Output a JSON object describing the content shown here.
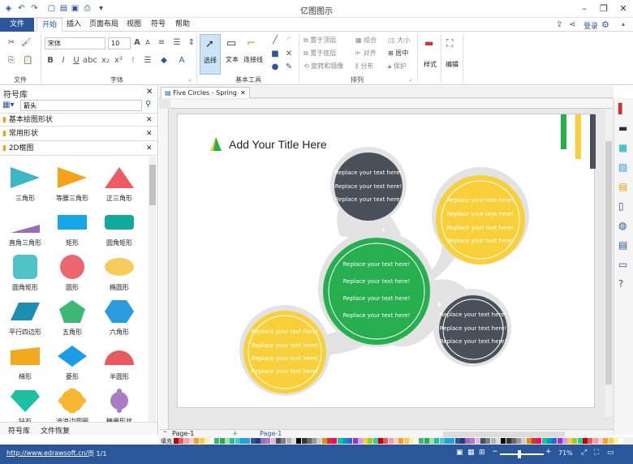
{
  "app": {
    "title": "亿图图示"
  },
  "window": {
    "login": "登录"
  },
  "tabs": [
    "文件",
    "开始",
    "插入",
    "页面布局",
    "视图",
    "符号",
    "帮助"
  ],
  "ribbon": {
    "font_name": "宋体",
    "font_size": "10",
    "groups": {
      "file": "文件",
      "font": "字体",
      "basic_tools": "基本工具",
      "arrange": "排列"
    },
    "tools": {
      "select": "选择",
      "text": "文本",
      "connector": "连接线"
    },
    "arrange": {
      "bring_front": "置于顶层",
      "send_back": "置于底层",
      "rotate": "旋转和镜像",
      "group": "组合",
      "align": "对齐",
      "distribute": "分布",
      "size": "大小",
      "center": "居中",
      "protect": "保护"
    },
    "style": "样式",
    "edit": "编辑"
  },
  "library": {
    "title": "符号库",
    "search_value": "箭头",
    "categories": [
      "基本绘图形状",
      "常用形状",
      "2D框图"
    ],
    "shapes": [
      {
        "label": "三角形",
        "color": "#3fb6c4"
      },
      {
        "label": "等腰三角形",
        "color": "#f7a21b"
      },
      {
        "label": "正三角形",
        "color": "#ec5b62"
      },
      {
        "label": "直角三角形",
        "color": "#9b6bb5"
      },
      {
        "label": "矩形",
        "color": "#16a6e8"
      },
      {
        "label": "圆角矩形",
        "color": "#11a99a"
      },
      {
        "label": "圆角矩形",
        "color": "#4fc3c8"
      },
      {
        "label": "圆形",
        "color": "#ec6670"
      },
      {
        "label": "椭圆形",
        "color": "#f8cc5c"
      },
      {
        "label": "平行四边形",
        "color": "#1b8fb0"
      },
      {
        "label": "五角形",
        "color": "#3eb875"
      },
      {
        "label": "六角形",
        "color": "#2b9be0"
      },
      {
        "label": "梯形",
        "color": "#f4a81d"
      },
      {
        "label": "菱形",
        "color": "#1c9be8"
      },
      {
        "label": "半圆形",
        "color": "#e8585f"
      },
      {
        "label": "钻石",
        "color": "#1cc1a4"
      },
      {
        "label": "波浪边圆圈",
        "color": "#f7b733"
      },
      {
        "label": "糖果形状",
        "color": "#a97cc4"
      }
    ],
    "bottom_tabs": [
      "符号库",
      "文件恢复"
    ]
  },
  "doc": {
    "tab": "Five Circles - Spring",
    "title": "Add Your Title Here",
    "placeholder": "Replace your text here!"
  },
  "page_tabs": {
    "current": "Page-1",
    "active": "Page-1"
  },
  "fill_label": "填充",
  "status": {
    "url": "http://www.edrawsoft.cn/",
    "page": "页 1/1",
    "zoom": "71%"
  },
  "colors": {
    "accent": "#2b579a",
    "green": "#27ae4f",
    "yellow": "#f9d03a",
    "dark": "#4a5059"
  }
}
